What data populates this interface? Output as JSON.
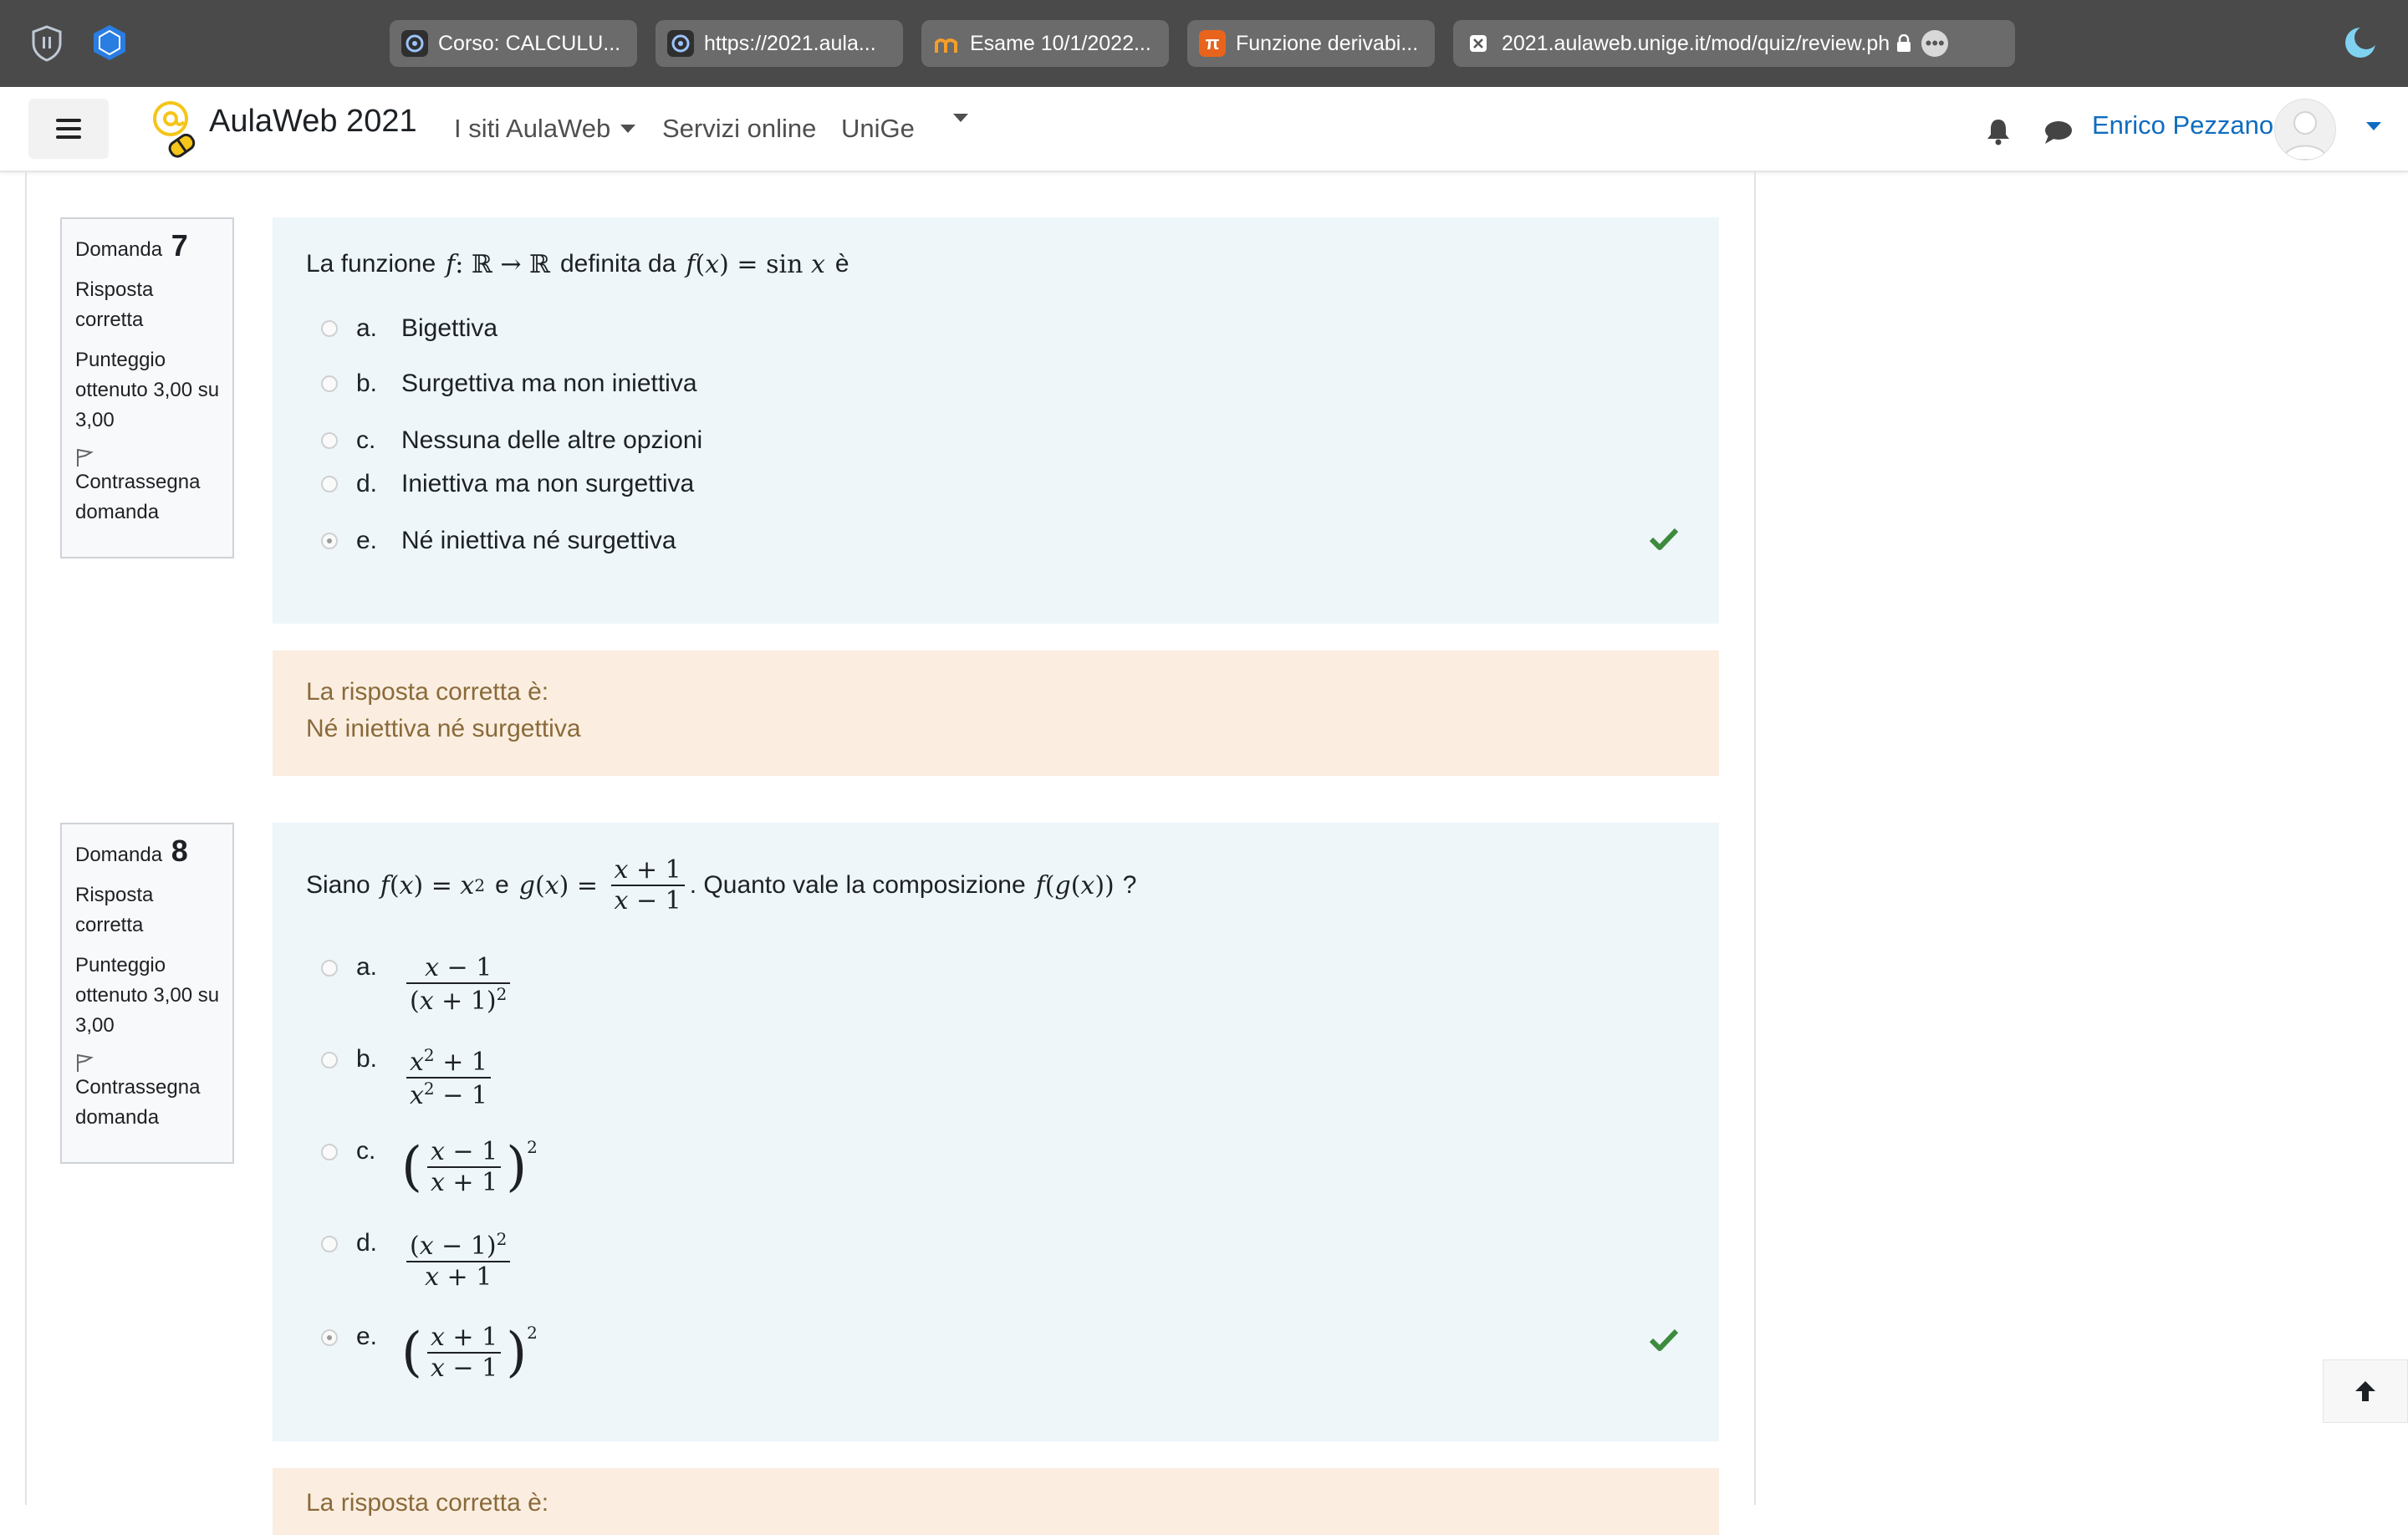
{
  "browser": {
    "tabs": [
      {
        "title": "Corso: CALCULU...",
        "icon": "aulaweb-favicon"
      },
      {
        "title": "https://2021.aula...",
        "icon": "aulaweb-favicon"
      },
      {
        "title": "Esame 10/1/2022...",
        "icon": "moodle-favicon"
      },
      {
        "title": "Funzione derivabi...",
        "icon": "pi-favicon"
      }
    ],
    "active_url": "2021.aulaweb.unige.it/mod/quiz/review.ph"
  },
  "navbar": {
    "brand": "AulaWeb 2021",
    "menu": [
      "I siti AulaWeb",
      "Servizi online",
      "UniGe"
    ],
    "user_name": "Enrico Pezzano"
  },
  "questions": [
    {
      "label": "Domanda",
      "number": "7",
      "status": "Risposta corretta",
      "score": "Punteggio ottenuto 3,00 su 3,00",
      "flag_label": "Contrassegna domanda",
      "text_prefix": "La funzione",
      "text_mid": "definita da",
      "text_suffix": "è",
      "options": [
        {
          "letter": "a.",
          "text": "Bigettiva"
        },
        {
          "letter": "b.",
          "text": "Surgettiva ma non iniettiva"
        },
        {
          "letter": "c.",
          "text": "Nessuna delle altre opzioni"
        },
        {
          "letter": "d.",
          "text": "Iniettiva ma non surgettiva"
        },
        {
          "letter": "e.",
          "text": "Né iniettiva né surgettiva",
          "selected": true,
          "correct": true
        }
      ],
      "feedback_title": "La risposta corretta è:",
      "feedback_answer": "Né iniettiva né surgettiva"
    },
    {
      "label": "Domanda",
      "number": "8",
      "status": "Risposta corretta",
      "score": "Punteggio ottenuto 3,00 su 3,00",
      "flag_label": "Contrassegna domanda",
      "text_prefix": "Siano",
      "text_and": "e",
      "text_suffix": ". Quanto vale la composizione",
      "text_end": "?",
      "options": [
        {
          "letter": "a."
        },
        {
          "letter": "b."
        },
        {
          "letter": "c."
        },
        {
          "letter": "d."
        },
        {
          "letter": "e.",
          "selected": true,
          "correct": true
        }
      ],
      "feedback_title": "La risposta corretta è:"
    }
  ],
  "colors": {
    "question_bg": "#eef6fa",
    "feedback_bg": "#fbeee0",
    "check_green": "#3d8b3d",
    "link_blue": "#0f6cbf"
  }
}
